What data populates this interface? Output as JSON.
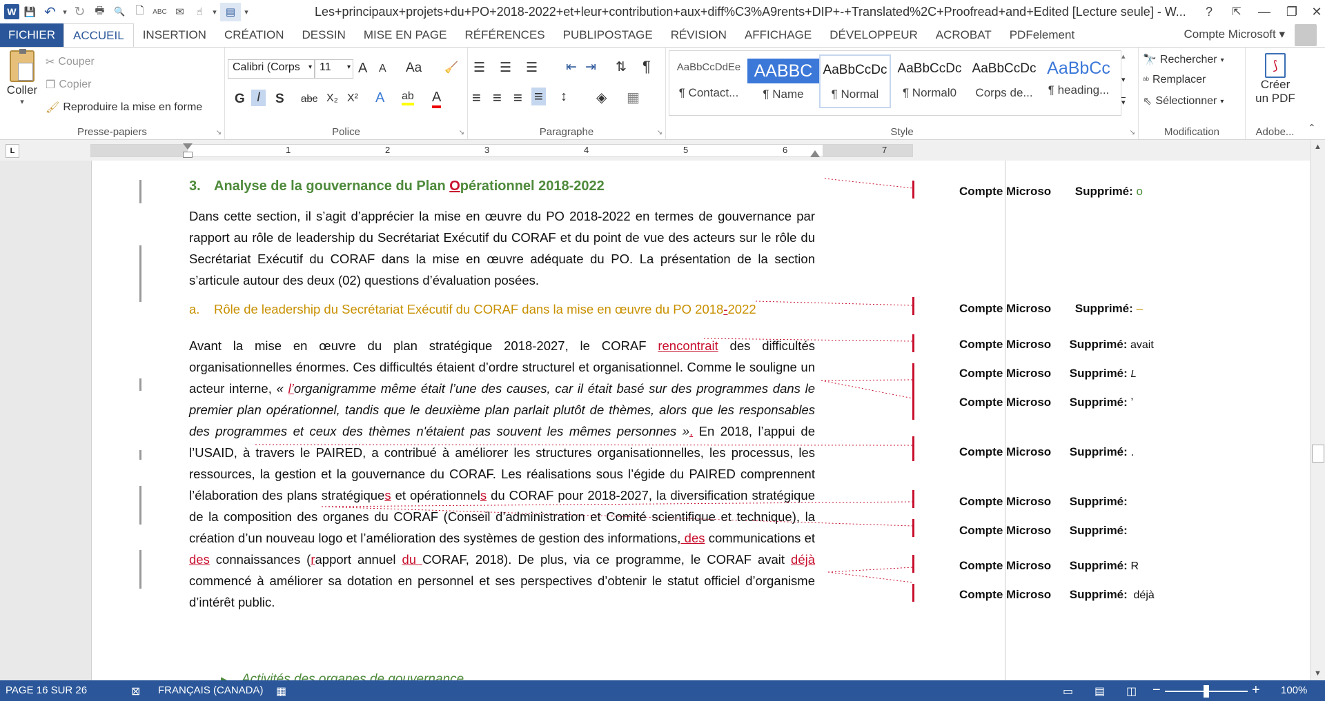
{
  "window": {
    "title": "Les+principaux+projets+du+PO+2018-2022+et+leur+contribution+aux+diff%C3%A9rents+DIP+-+Translated%2C+Proofread+and+Edited [Lecture seule] - W...",
    "help": "?",
    "ribbon_display": "⇱",
    "minimize": "—",
    "maximize": "❐",
    "close": "✕"
  },
  "qat": {
    "word_icon": "W",
    "save": "💾",
    "undo": "↶",
    "undo_dd": "▾",
    "redo": "↻",
    "print": "🖶",
    "preview": "🔍",
    "new": "🗋",
    "spell": "ABC",
    "email": "✉",
    "touch": "☝",
    "more": "▾",
    "layout": "▤",
    "customize": "▾"
  },
  "tabs": [
    "FICHIER",
    "ACCUEIL",
    "INSERTION",
    "CRÉATION",
    "DESSIN",
    "MISE EN PAGE",
    "RÉFÉRENCES",
    "PUBLIPOSTAGE",
    "RÉVISION",
    "AFFICHAGE",
    "DÉVELOPPEUR",
    "ACROBAT",
    "PDFelement"
  ],
  "account": "Compte Microsoft ▾",
  "ribbon": {
    "clipboard": {
      "paste": "Coller",
      "paste_dd": "▾",
      "cut": "Couper",
      "copy": "Copier",
      "format_painter": "Reproduire la mise en forme",
      "label": "Presse-papiers"
    },
    "font": {
      "name": "Calibri (Corps",
      "size": "11",
      "grow": "A",
      "shrink": "A",
      "case": "Aa",
      "clear": "🧹",
      "bold": "G",
      "italic": "I",
      "underline": "S",
      "strike": "abc",
      "sub": "X₂",
      "sup": "X²",
      "effects": "A",
      "highlight": "ab",
      "color": "A",
      "label": "Police"
    },
    "paragraph": {
      "bullets": "☰",
      "numbering": "☰",
      "multilevel": "☰",
      "outdent": "⇤",
      "indent": "⇥",
      "sort": "⇅",
      "pilcrow": "¶",
      "left": "≡",
      "center": "≡",
      "right": "≡",
      "justify": "≡",
      "spacing": "↕",
      "shading": "◈",
      "borders": "▦",
      "label": "Paragraphe"
    },
    "styles": {
      "items": [
        {
          "preview": "AaBbCcDdEe",
          "name": "¶ Contact..."
        },
        {
          "preview": "AABBC",
          "name": "¶ Name"
        },
        {
          "preview": "AaBbCcDc",
          "name": "¶ Normal"
        },
        {
          "preview": "AaBbCcDc",
          "name": "¶ Normal0"
        },
        {
          "preview": "AaBbCcDc",
          "name": "Corps de..."
        },
        {
          "preview": "AaBbCc",
          "name": "¶ heading..."
        }
      ],
      "up": "▴",
      "down": "▾",
      "more": "▾",
      "label": "Style"
    },
    "editing": {
      "find": "Rechercher",
      "replace": "Remplacer",
      "select": "Sélectionner",
      "label": "Modification"
    },
    "adobe": {
      "create_pdf_1": "Créer",
      "create_pdf_2": "un PDF",
      "label": "Adobe..."
    },
    "collapse": "⌃",
    "launcher": "↘"
  },
  "ruler": {
    "corner": "L",
    "numbers": [
      "1",
      "2",
      "3",
      "4",
      "5",
      "6",
      "7"
    ]
  },
  "document": {
    "heading3_num": "3.",
    "heading3_pre": "Analyse de la gouvernance du Plan ",
    "heading3_ins": "O",
    "heading3_post": "pérationnel 2018-2022",
    "intro": "Dans cette section, il s’agit d’apprécier la mise en œuvre du PO 2018-2022 en termes de gouvernance par rapport au rôle de leadership du Secrétariat Exécutif du CORAF et du point de vue des acteurs sur le rôle du Secrétariat Exécutif du CORAF dans la mise en œuvre adéquate du PO. La présentation de la section s’articule autour des deux (02) questions d’évaluation posées.",
    "heading4_num": "a.",
    "heading4_pre": "Rôle de leadership du Secrétariat Exécutif du CORAF dans la mise en œuvre du PO 2018",
    "heading4_ins": "-",
    "heading4_post": "2022",
    "p_1": "Avant la mise en œuvre du plan stratégique 2018-2027, le CORAF ",
    "p_ins_1": "rencontrait",
    "p_2": " des difficultés organisationnelles énormes. Ces difficultés étaient d’ordre structurel et organisationnel. Comme le souligne un acteur interne, ",
    "p_quote_open": "« ",
    "p_ins_2": "l’",
    "p_quote": "organigramme même était l’une des causes, car il était basé sur des programmes dans le premier plan opérationnel, tandis que le deuxième plan parlait plutôt de thèmes, alors que les responsables des programmes et ceux des thèmes n'étaient pas souvent les mêmes personnes »",
    "p_ins_3": ".",
    "p_3": " En 2018, l’appui de l’USAID, à travers le PAIRED, a contribué à améliorer les structures organisationnelles, les processus, les ressources, la gestion et la gouvernance du CORAF. Les réalisations sous l’égide du PAIRED comprennent l’élaboration des plans stratégique",
    "p_ins_4": "s",
    "p_4": " et opérationnel",
    "p_ins_5": "s",
    "p_5": " du CORAF pour 2018-2027, la diversification stratégique de la composition des organes du CORAF (Conseil d’administration et Comité scientifique et technique), la création d’un nouveau logo et l’amélioration des systèmes de gestion des informations,",
    "p_ins_6": " des",
    "p_6": " communications et",
    "p_ins_7": " des",
    "p_7": " connaissances (",
    "p_ins_8": "r",
    "p_8": "apport annuel ",
    "p_ins_9": "du ",
    "p_9": "CORAF, 2018). De plus, via ce programme, le CORAF avait ",
    "p_ins_10": "déjà ",
    "p_10": "commencé à améliorer sa dotation en personnel et ses perspectives d’obtenir le statut officiel d’organisme d’intérêt public.",
    "next_heading": "Activités des organes de gouvernance"
  },
  "balloons": [
    {
      "author": "Compte Microso",
      "label": "Supprimé:",
      "text": "o"
    },
    {
      "author": "Compte Microso",
      "label": "Supprimé:",
      "text": "–"
    },
    {
      "author": "Compte Microso",
      "label": "Supprimé:",
      "text": "avait"
    },
    {
      "author": "Compte Microso",
      "label": "Supprimé:",
      "text": "L"
    },
    {
      "author": "Compte Microso",
      "label": "Supprimé:",
      "text": "’"
    },
    {
      "author": "Compte Microso",
      "label": "Supprimé:",
      "text": "."
    },
    {
      "author": "Compte Microso",
      "label": "Supprimé:",
      "text": ""
    },
    {
      "author": "Compte Microso",
      "label": "Supprimé:",
      "text": ""
    },
    {
      "author": "Compte Microso",
      "label": "Supprimé:",
      "text": "R"
    },
    {
      "author": "Compte Microso",
      "label": "Supprimé:",
      "text": "déjà"
    }
  ],
  "status": {
    "page": "PAGE 16 SUR 26",
    "language": "FRANÇAIS (CANADA)",
    "zoom": "100%",
    "zoom_minus": "−",
    "zoom_plus": "+",
    "zoom_level": 1.0
  },
  "colors": {
    "accent": "#2b579a",
    "revision": "#c8102e",
    "heading3": "#4e8a3b",
    "heading4": "#c89000"
  }
}
